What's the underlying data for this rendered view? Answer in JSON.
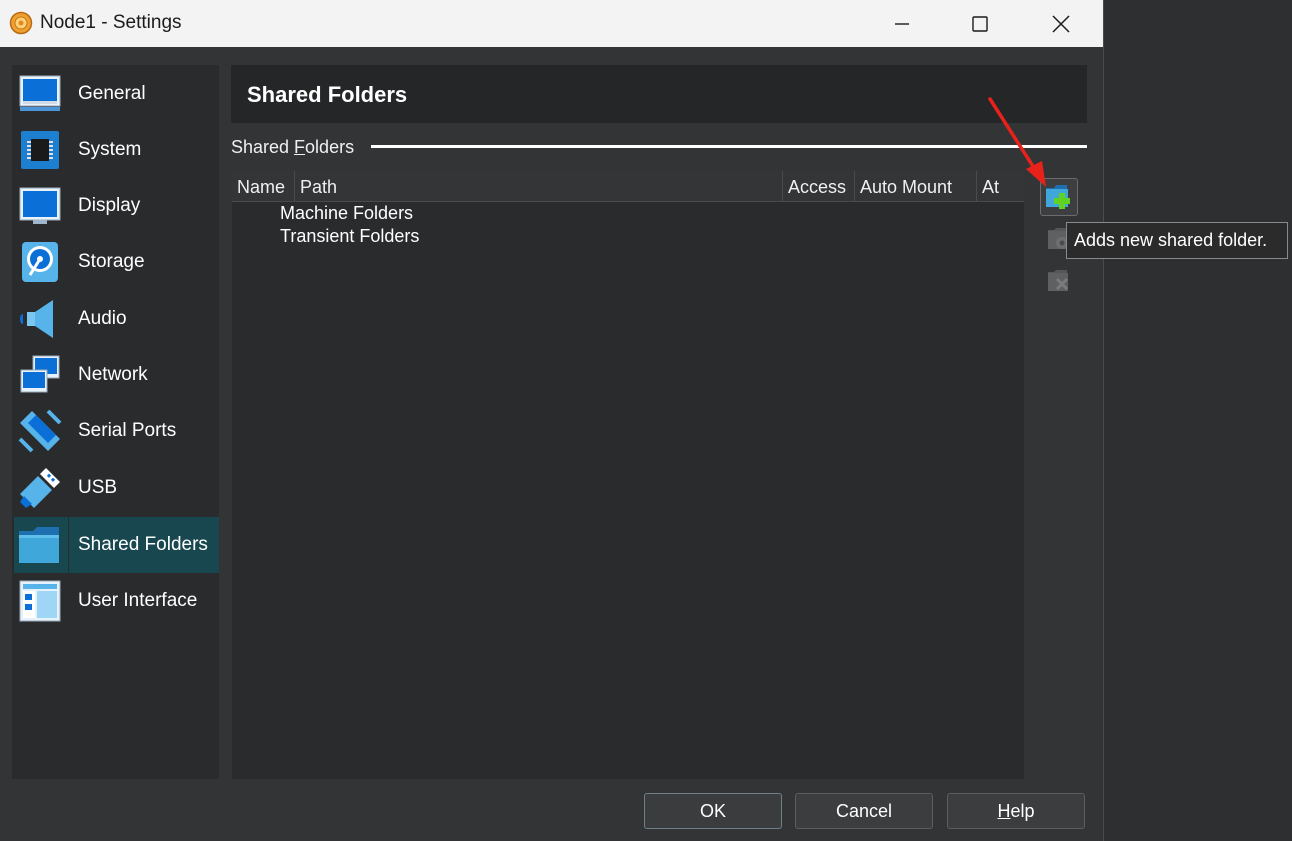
{
  "window": {
    "title": "Node1 - Settings"
  },
  "sidebar": {
    "items": [
      {
        "label": "General",
        "icon": "monitor-general-icon"
      },
      {
        "label": "System",
        "icon": "chip-icon"
      },
      {
        "label": "Display",
        "icon": "display-icon"
      },
      {
        "label": "Storage",
        "icon": "disk-icon"
      },
      {
        "label": "Audio",
        "icon": "speaker-icon"
      },
      {
        "label": "Network",
        "icon": "network-icon"
      },
      {
        "label": "Serial Ports",
        "icon": "serial-port-icon"
      },
      {
        "label": "USB",
        "icon": "usb-icon"
      },
      {
        "label": "Shared Folders",
        "icon": "folder-icon"
      },
      {
        "label": "User Interface",
        "icon": "window-layout-icon"
      }
    ],
    "selected": "Shared Folders"
  },
  "page": {
    "title": "Shared Folders",
    "group_label_pre": "Shared ",
    "group_label_mnemonic": "F",
    "group_label_post": "olders"
  },
  "table": {
    "columns": [
      "Name",
      "Path",
      "Access",
      "Auto Mount",
      "At"
    ],
    "rows": [
      "Machine Folders",
      "Transient Folders"
    ]
  },
  "toolbar": {
    "add_icon": "add-folder-icon",
    "edit_icon": "edit-folder-icon",
    "remove_icon": "remove-folder-icon"
  },
  "tooltip": {
    "text": "Adds new shared folder."
  },
  "buttons": {
    "ok": "OK",
    "cancel": "Cancel",
    "help_mnemonic": "H",
    "help_rest": "elp"
  },
  "colors": {
    "selection": "#19474f",
    "accent_arrow": "#e8221b",
    "add_plus": "#5fd31f"
  }
}
